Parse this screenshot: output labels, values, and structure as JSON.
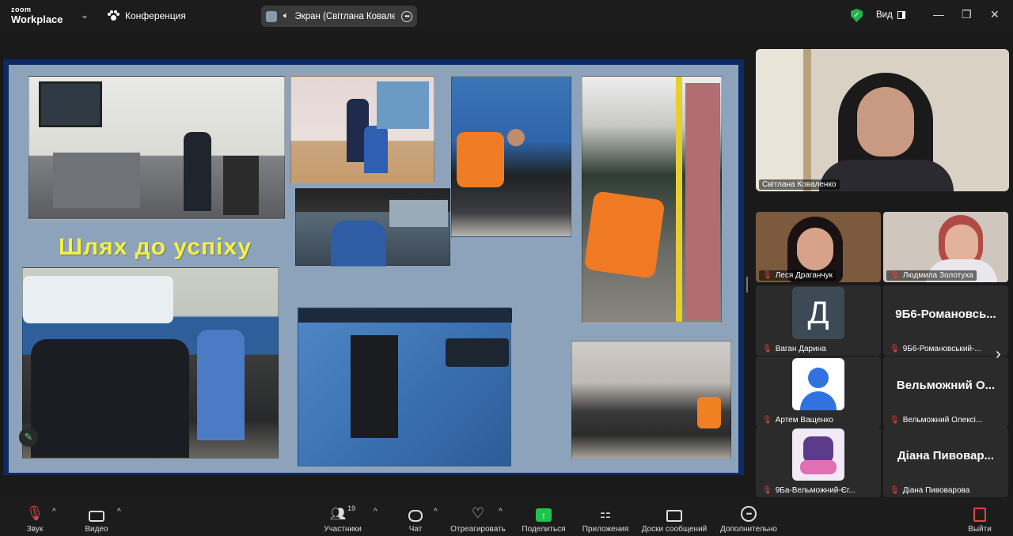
{
  "app": {
    "logo_line1": "zoom",
    "logo_line2": "Workplace",
    "meeting_title": "Конференция",
    "share_indicator": "Экран (Світлана Коваленко)",
    "view_label": "Вид",
    "accent_color": "#1fc44f",
    "secure_color": "#23b14d"
  },
  "slide": {
    "title": "Шлях до успіху"
  },
  "participants": {
    "main": {
      "name": "Світлана Коваленко"
    },
    "tiles": [
      {
        "name": "Леся Драганчук",
        "type": "video"
      },
      {
        "name": "Людмила Золотуха",
        "type": "video"
      },
      {
        "name": "Ваган Дарина",
        "type": "avatar-letter",
        "letter": "Д"
      },
      {
        "name": "9Б6-Романовський-...",
        "big_name": "9Б6-Романовсь...",
        "type": "name-only"
      },
      {
        "name": "Артем Ващенко",
        "type": "avatar-user"
      },
      {
        "name": "Вельможний Олексі...",
        "big_name": "Вельможний О...",
        "type": "name-only"
      },
      {
        "name": "9Ба-Вельможний-Єг...",
        "type": "avatar-image"
      },
      {
        "name": "Діана Пивоварова",
        "big_name": "Діана Пивовар...",
        "type": "name-only"
      }
    ]
  },
  "toolbar": {
    "audio": "Звук",
    "video": "Видео",
    "participants": "Участники",
    "participants_count": "19",
    "chat": "Чат",
    "react": "Отреагировать",
    "share": "Поделиться",
    "apps": "Приложения",
    "whiteboards": "Доски сообщений",
    "more": "Дополнительно",
    "leave": "Выйти"
  }
}
